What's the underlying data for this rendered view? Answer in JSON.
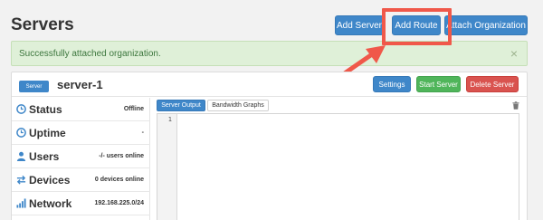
{
  "header": {
    "title": "Servers",
    "buttons": {
      "add_server": "Add Server",
      "add_route": "Add Route",
      "attach_organization": "Attach Organization"
    }
  },
  "alert": {
    "message": "Successfully attached organization.",
    "close": "×"
  },
  "server": {
    "badge": "Server",
    "name": "server-1",
    "actions": {
      "settings": "Settings",
      "start": "Start Server",
      "delete": "Delete Server"
    },
    "stats": [
      {
        "label": "Status",
        "value": "Offline",
        "icon": "clock-icon"
      },
      {
        "label": "Uptime",
        "value": "-",
        "icon": "clock-icon"
      },
      {
        "label": "Users",
        "value": "-/- users online",
        "icon": "user-icon"
      },
      {
        "label": "Devices",
        "value": "0 devices online",
        "icon": "exchange-icon"
      },
      {
        "label": "Network",
        "value": "192.168.225.0/24",
        "icon": "signal-icon"
      }
    ],
    "tabs": {
      "server_output": "Server Output",
      "bandwidth_graphs": "Bandwidth Graphs"
    },
    "editor": {
      "line_number": "1"
    }
  },
  "colors": {
    "primary": "#3f87c9",
    "success": "#4fb55a",
    "danger": "#d9534f",
    "annotation": "#f0584a"
  }
}
